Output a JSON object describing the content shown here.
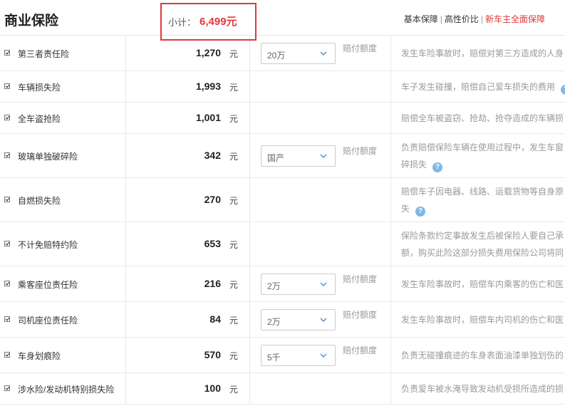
{
  "header": {
    "title": "商业保险",
    "subtotal_label": "小计：",
    "subtotal_value": "6,499元",
    "plans": [
      "基本保障",
      "高性价比",
      "新车主全面保障"
    ],
    "active_plan_color": "#e0373b"
  },
  "rows": [
    {
      "checked": true,
      "name": "第三者责任险",
      "price": "1,270",
      "unit": "元",
      "option": "20万",
      "limit_label": "赔付额度",
      "desc": [
        "发生车险事故时，赔偿对第三方造成的人身"
      ]
    },
    {
      "checked": true,
      "name": "车辆损失险",
      "price": "1,993",
      "unit": "元",
      "desc": [
        "车子发生碰撞，赔偿自己爱车损失的费用"
      ],
      "help": true
    },
    {
      "checked": true,
      "name": "全车盗抢险",
      "price": "1,001",
      "unit": "元",
      "desc": [
        "赔偿全车被盗窃、抢劫、抢夺造成的车辆损"
      ]
    },
    {
      "checked": true,
      "name": "玻璃单独破碎险",
      "price": "342",
      "unit": "元",
      "option": "国产",
      "limit_label": "赔付额度",
      "desc": [
        "负责赔偿保险车辆在使用过程中，发生车窗",
        "碎损失"
      ],
      "help": true
    },
    {
      "checked": true,
      "name": "自燃损失险",
      "price": "270",
      "unit": "元",
      "desc": [
        "赔偿车子因电器、线路、运载货物等自身原",
        "失"
      ],
      "help": true
    },
    {
      "checked": true,
      "name": "不计免赔特约险",
      "price": "653",
      "unit": "元",
      "desc": [
        "保险条款约定事故发生后被保险人要自己承",
        "额，购买此险这部分损失费用保险公司将同"
      ]
    },
    {
      "checked": true,
      "name": "乘客座位责任险",
      "price": "216",
      "unit": "元",
      "option": "2万",
      "limit_label": "赔付额度",
      "desc": [
        "发生车险事故时，赔偿车内乘客的伤亡和医"
      ]
    },
    {
      "checked": true,
      "name": "司机座位责任险",
      "price": "84",
      "unit": "元",
      "option": "2万",
      "limit_label": "赔付额度",
      "desc": [
        "发生车险事故时，赔偿车内司机的伤亡和医"
      ]
    },
    {
      "checked": true,
      "name": "车身划痕险",
      "price": "570",
      "unit": "元",
      "option": "5千",
      "limit_label": "赔付额度",
      "desc": [
        "负责无碰撞痕迹的车身表面油漆单独划伤的"
      ]
    },
    {
      "checked": true,
      "name": "涉水险/发动机特别损失险",
      "price": "100",
      "unit": "元",
      "desc": [
        "负责爱车被水淹导致发动机受损所造成的损"
      ]
    }
  ]
}
